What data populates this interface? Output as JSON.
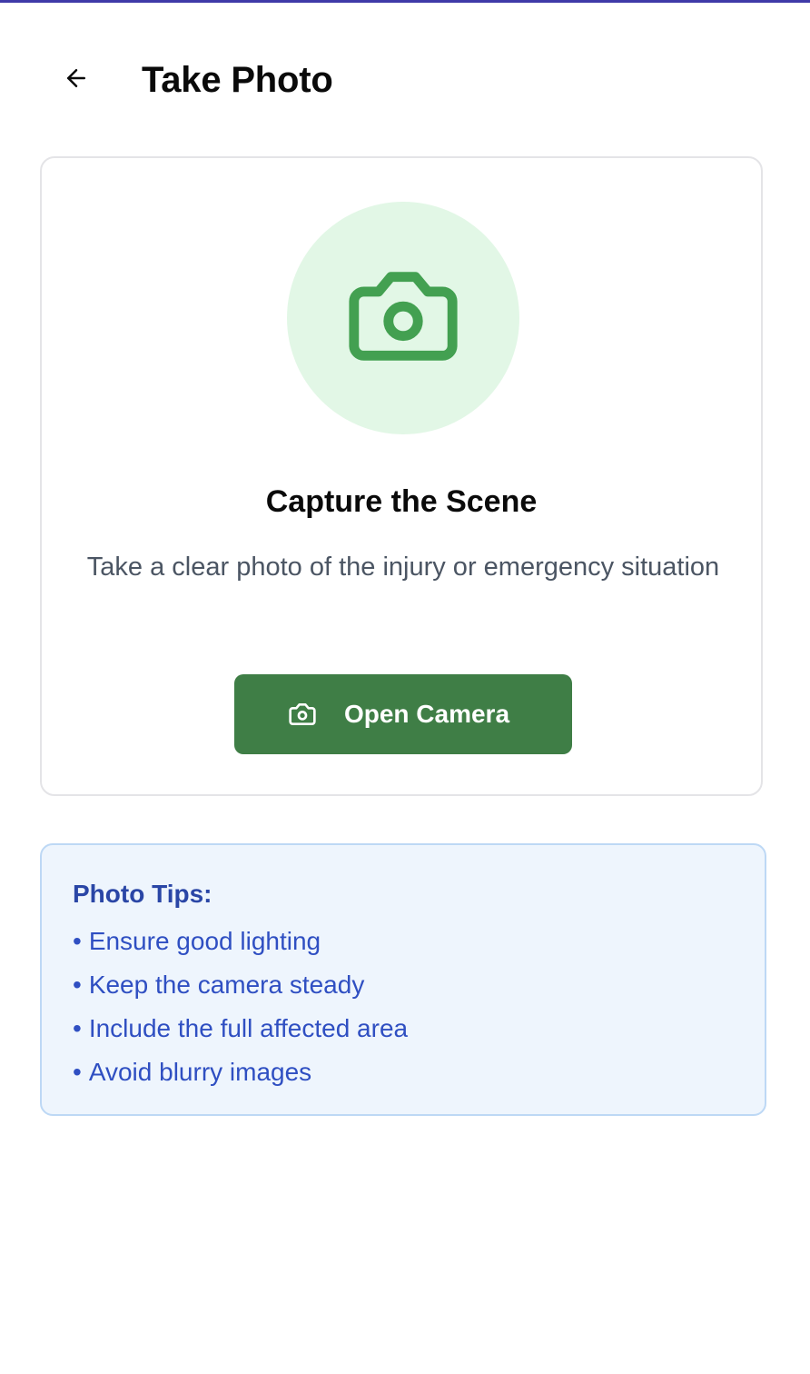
{
  "header": {
    "back_icon": "arrow-left-icon",
    "title": "Take Photo"
  },
  "capture": {
    "icon": "camera-icon",
    "title": "Capture the Scene",
    "description": "Take a clear photo of the injury or emergency situation",
    "button_icon": "camera-icon",
    "button_label": "Open Camera"
  },
  "tips": {
    "title": "Photo Tips:",
    "bullet": "•",
    "items": [
      "Ensure good lighting",
      "Keep the camera steady",
      "Include the full affected area",
      "Avoid blurry images"
    ]
  },
  "colors": {
    "accent_top": "#3f3aa8",
    "primary_green": "#3f7e46",
    "icon_circle_bg": "#e2f7e6",
    "tips_bg": "#eef5fd",
    "tips_text": "#2f4fc2"
  }
}
